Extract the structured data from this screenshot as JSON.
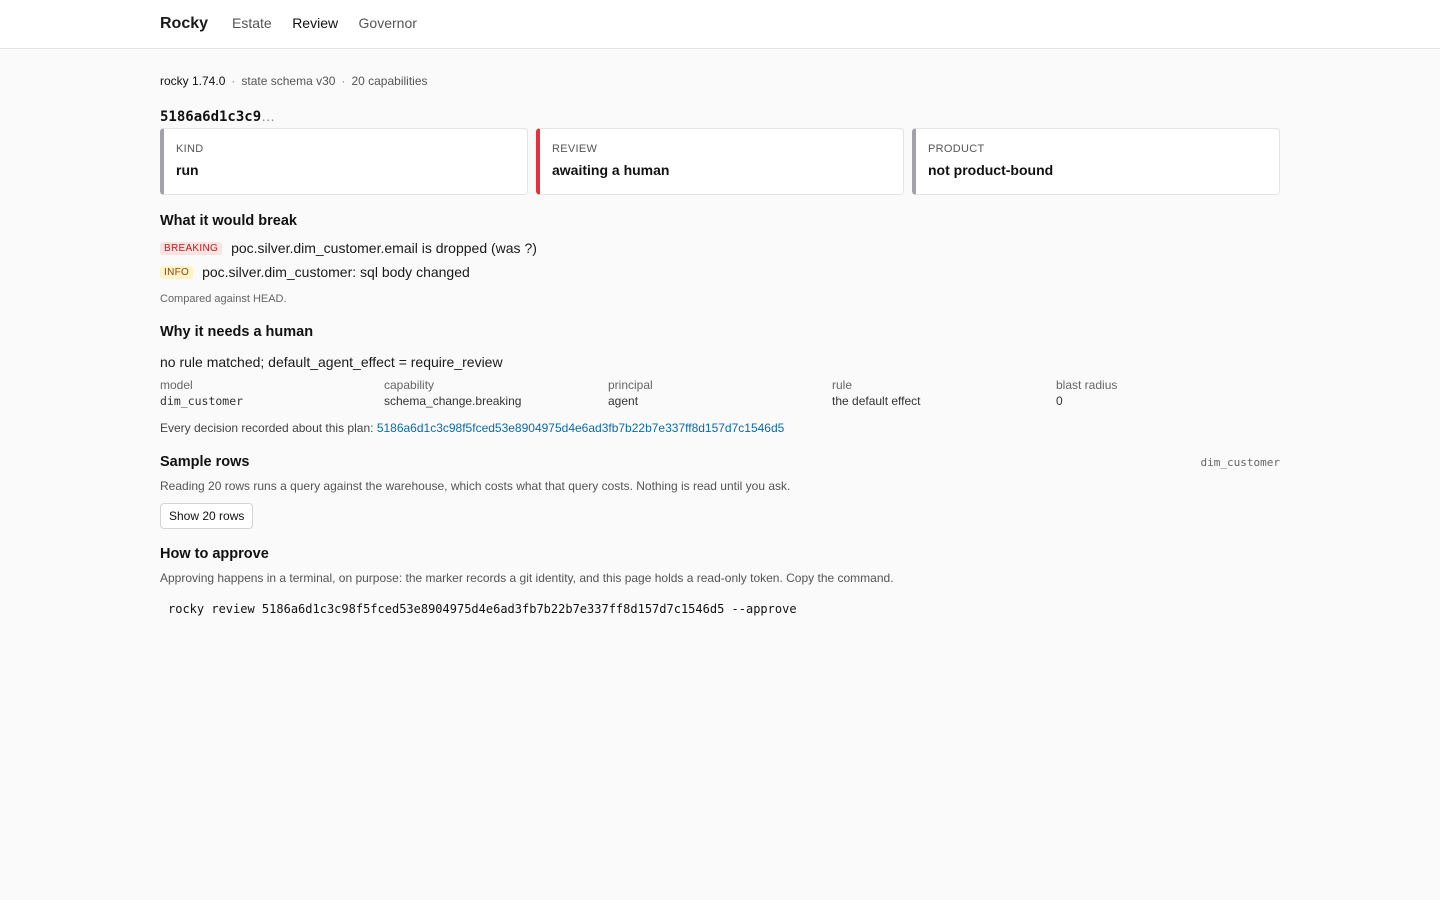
{
  "app": {
    "brand": "Rocky"
  },
  "nav": {
    "items": [
      "Estate",
      "Review",
      "Governor"
    ],
    "active": "Review"
  },
  "meta": {
    "version": "rocky 1.74.0",
    "schema": "state schema v30",
    "capabilities": "20 capabilities"
  },
  "plan": {
    "id_short": "5186a6d1c3c9",
    "ellipsis": "…"
  },
  "cards": [
    {
      "label": "KIND",
      "value": "run"
    },
    {
      "label": "REVIEW",
      "value": "awaiting a human"
    },
    {
      "label": "PRODUCT",
      "value": "not product-bound"
    }
  ],
  "breaks": {
    "title": "What it would break",
    "items": [
      {
        "badge": "BREAKING",
        "text": "poc.silver.dim_customer.email is dropped (was ?)"
      },
      {
        "badge": "INFO",
        "text": "poc.silver.dim_customer: sql body changed"
      }
    ],
    "note": "Compared against HEAD."
  },
  "human": {
    "title": "Why it needs a human",
    "reason": "no rule matched; default_agent_effect = require_review",
    "facts": [
      {
        "k": "model",
        "v": "dim_customer"
      },
      {
        "k": "capability",
        "v": "schema_change.breaking"
      },
      {
        "k": "principal",
        "v": "agent"
      },
      {
        "k": "rule",
        "v": "the default effect"
      },
      {
        "k": "blast radius",
        "v": "0"
      }
    ],
    "decisions_label": "Every decision recorded about this plan:",
    "plan_hash": "5186a6d1c3c98f5fced53e8904975d4e6ad3fb7b22b7e337ff8d157d7c1546d5"
  },
  "sample": {
    "title": "Sample rows",
    "model": "dim_customer",
    "desc": "Reading 20 rows runs a query against the warehouse, which costs what that query costs. Nothing is read until you ask.",
    "button": "Show 20 rows"
  },
  "approve": {
    "title": "How to approve",
    "desc": "Approving happens in a terminal, on purpose: the marker records a git identity, and this page holds a read-only token. Copy the command.",
    "command": "rocky review 5186a6d1c3c98f5fced53e8904975d4e6ad3fb7b22b7e337ff8d157d7c1546d5 --approve"
  }
}
